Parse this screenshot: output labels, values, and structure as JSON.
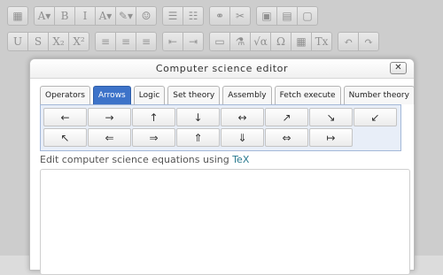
{
  "toolbar": {
    "row1": [
      [
        "table-icon"
      ],
      [
        "font-size-icon",
        "bold-icon",
        "italic-icon",
        "text-color-icon",
        "highlight-icon",
        "emoticon-icon"
      ],
      [
        "bullet-list-icon",
        "numbered-list-icon"
      ],
      [
        "link-icon",
        "unlink-icon"
      ],
      [
        "image-icon",
        "media-icon",
        "paste-icon"
      ]
    ],
    "row1_glyphs": {
      "table-icon": "▦",
      "font-size-icon": "A▾",
      "bold-icon": "B",
      "italic-icon": "I",
      "text-color-icon": "A▾",
      "highlight-icon": "✎▾",
      "emoticon-icon": "☺",
      "bullet-list-icon": "☰",
      "numbered-list-icon": "☷",
      "link-icon": "⚭",
      "unlink-icon": "✂",
      "image-icon": "▣",
      "media-icon": "▤",
      "paste-icon": "▢"
    },
    "row2": [
      [
        "underline-icon",
        "strikethrough-icon",
        "subscript-icon",
        "superscript-icon"
      ],
      [
        "align-left-icon",
        "align-center-icon",
        "align-right-icon"
      ],
      [
        "outdent-icon",
        "indent-icon"
      ],
      [
        "screen-icon",
        "flask-icon",
        "sqrt-icon",
        "omega-icon",
        "grid-icon",
        "clear-format-icon"
      ],
      [
        "undo-icon",
        "redo-icon"
      ]
    ],
    "row2_glyphs": {
      "underline-icon": "U",
      "strikethrough-icon": "S",
      "subscript-icon": "X₂",
      "superscript-icon": "X²",
      "align-left-icon": "≡",
      "align-center-icon": "≡",
      "align-right-icon": "≡",
      "outdent-icon": "⇤",
      "indent-icon": "⇥",
      "screen-icon": "▭",
      "flask-icon": "⚗",
      "sqrt-icon": "√α",
      "omega-icon": "Ω",
      "grid-icon": "▦",
      "clear-format-icon": "Tx",
      "undo-icon": "↶",
      "redo-icon": "↷"
    }
  },
  "dialog": {
    "title": "Computer science editor",
    "close_label": "✕"
  },
  "tabs": [
    "Operators",
    "Arrows",
    "Logic",
    "Set theory",
    "Assembly",
    "Fetch execute",
    "Number theory"
  ],
  "active_tab": "Arrows",
  "symbols": [
    "←",
    "→",
    "↑",
    "↓",
    "↔",
    "↗",
    "↘",
    "↙",
    "↖",
    "⇐",
    "⇒",
    "⇑",
    "⇓",
    "⇔",
    "↦"
  ],
  "caption": {
    "text": "Edit computer science equations using ",
    "link": "TeX"
  },
  "colors": {
    "active_tab": "#3d73c9",
    "panel_bg": "#e8eef8",
    "tex_link": "#2a7a8f"
  }
}
